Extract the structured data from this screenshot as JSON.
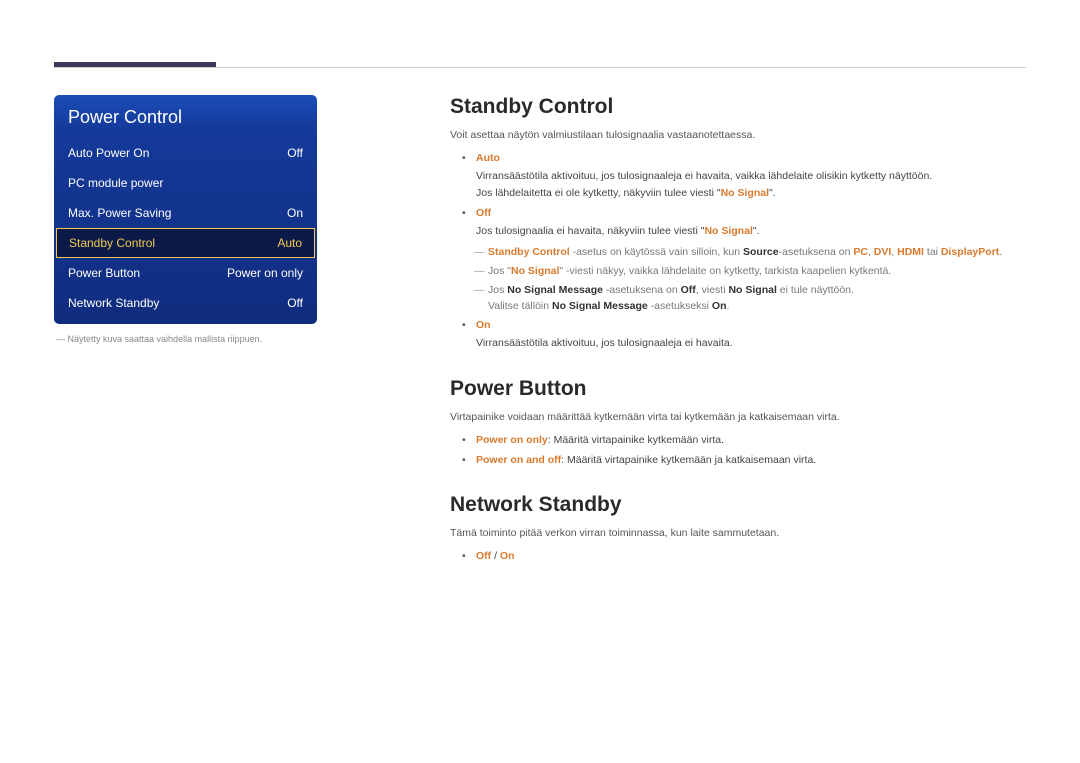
{
  "menu": {
    "title": "Power Control",
    "items": [
      {
        "label": "Auto Power On",
        "value": "Off"
      },
      {
        "label": "PC module power",
        "value": ""
      },
      {
        "label": "Max. Power Saving",
        "value": "On"
      },
      {
        "label": "Standby Control",
        "value": "Auto"
      },
      {
        "label": "Power Button",
        "value": "Power on only"
      },
      {
        "label": "Network Standby",
        "value": "Off"
      }
    ],
    "note": "― Näytetty kuva saattaa vaihdella mallista riippuen."
  },
  "sections": {
    "standby": {
      "title": "Standby Control",
      "intro": "Voit asettaa näytön valmiustilaan tulosignaalia vastaanotettaessa.",
      "auto": {
        "label": "Auto",
        "line1": "Virransäästötila aktivoituu, jos tulosignaaleja ei havaita, vaikka lähdelaite olisikin kytketty näyttöön.",
        "line2_pre": "Jos lähdelaitetta ei ole kytketty, näkyviin tulee viesti \"",
        "line2_hl": "No Signal",
        "line2_post": "\"."
      },
      "off": {
        "label": "Off",
        "line1_pre": "Jos tulosignaalia ei havaita, näkyviin tulee viesti \"",
        "line1_hl": "No Signal",
        "line1_post": "\".",
        "n1": {
          "a": "Standby Control",
          "b": " -asetus on käytössä vain silloin, kun ",
          "c": "Source",
          "d": "-asetuksena on ",
          "e": "PC",
          "f": "DVI",
          "g": "HDMI",
          "h": " tai ",
          "i": "DisplayPort",
          "j": "."
        },
        "n2": {
          "a": "Jos \"",
          "b": "No Signal",
          "c": "\" -viesti näkyy, vaikka lähdelaite on kytketty, tarkista kaapelien kytkentä."
        },
        "n3": {
          "a": "Jos ",
          "b": "No Signal Message",
          "c": " -asetuksena on ",
          "d": "Off",
          "e": ", viesti ",
          "f": "No Signal",
          "g": " ei tule näyttöön.",
          "h": "Valitse tällöin ",
          "i": "No Signal Message",
          "j": " -asetukseksi ",
          "k": "On",
          "l": "."
        }
      },
      "on": {
        "label": "On",
        "line1": "Virransäästötila aktivoituu, jos tulosignaaleja ei havaita."
      }
    },
    "powerbtn": {
      "title": "Power Button",
      "intro": "Virtapainike voidaan määrittää kytkemään virta tai kytkemään ja katkaisemaan virta.",
      "opt1": {
        "label": "Power on only",
        "text": ": Määritä virtapainike kytkemään virta."
      },
      "opt2": {
        "label": "Power on and off",
        "text": ": Määritä virtapainike kytkemään ja katkaisemaan virta."
      }
    },
    "network": {
      "title": "Network Standby",
      "intro": "Tämä toiminto pitää verkon virran toiminnassa, kun laite sammutetaan.",
      "opt_off": "Off",
      "opt_sep": " / ",
      "opt_on": "On"
    }
  }
}
